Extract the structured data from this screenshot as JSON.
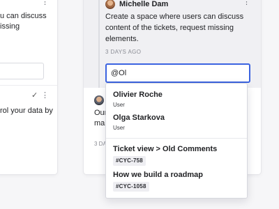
{
  "left_card": {
    "kebab_glyph": "⋮",
    "text_lines": "u can discuss\nissing",
    "check_glyph": "✓",
    "text2_lines": "rol your data by"
  },
  "thread": {
    "author": "Michelle Dam",
    "kebab_glyph": "⋮",
    "comment": "Create a space where users can discuss content of the tickets, request missing elements.",
    "time": "3 DAYS AGO",
    "input_value": "@Ol",
    "second_text": "Our\nmak",
    "second_time": "3 DA"
  },
  "dropdown": {
    "users": [
      {
        "name": "Olivier Roche",
        "role": "User"
      },
      {
        "name": "Olga Starkova",
        "role": "User"
      }
    ],
    "tickets": [
      {
        "title": "Ticket view > Old Comments",
        "id": "#CYC-758"
      },
      {
        "title": "How we build a roadmap",
        "id": "#CYC-1058"
      }
    ]
  }
}
